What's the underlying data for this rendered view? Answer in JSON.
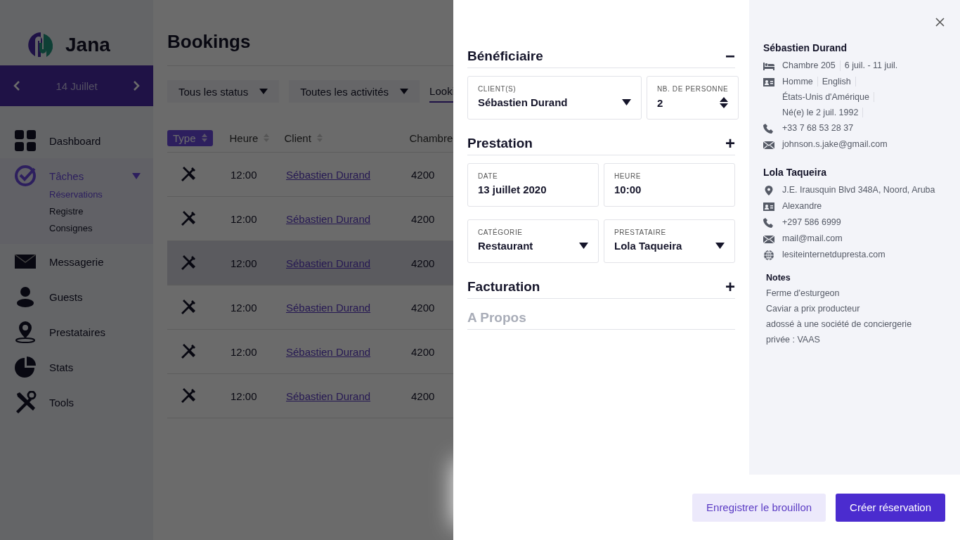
{
  "sidebar": {
    "brand": "Jana",
    "date": "14 Juillet",
    "nav": [
      {
        "label": "Dashboard",
        "selected": false
      },
      {
        "label": "Tâches",
        "selected": true,
        "expanded": true,
        "children": [
          {
            "label": "Réservations",
            "selected": true
          },
          {
            "label": "Registre",
            "selected": false
          },
          {
            "label": "Consignes",
            "selected": false
          }
        ]
      },
      {
        "label": "Messagerie",
        "selected": false
      },
      {
        "label": "Guests",
        "selected": false
      },
      {
        "label": "Prestataires",
        "selected": false
      },
      {
        "label": "Stats",
        "selected": false
      },
      {
        "label": "Tools",
        "selected": false
      }
    ]
  },
  "page": {
    "title": "Bookings",
    "filters": [
      {
        "kind": "select",
        "label": "Tous les status"
      },
      {
        "kind": "select",
        "label": "Toutes les activités"
      },
      {
        "kind": "search",
        "value": "Looki"
      }
    ],
    "table": {
      "columns": [
        {
          "label": "Type",
          "selected": true
        },
        {
          "label": "Heure",
          "selected": false
        },
        {
          "label": "Client",
          "selected": false
        },
        {
          "label": "Chambre",
          "selected": false
        }
      ],
      "rows": [
        {
          "time": "12:00",
          "client": "Sébastien Durand",
          "room": "4200",
          "highlighted": false
        },
        {
          "time": "12:00",
          "client": "Sébastien Durand",
          "room": "4200",
          "highlighted": false
        },
        {
          "time": "12:00",
          "client": "Sébastien Durand",
          "room": "4200",
          "highlighted": true
        },
        {
          "time": "12:00",
          "client": "Sébastien Durand",
          "room": "4200",
          "highlighted": false
        },
        {
          "time": "12:00",
          "client": "Sébastien Durand",
          "room": "4200",
          "highlighted": false
        },
        {
          "time": "12:00",
          "client": "Sébastien Durand",
          "room": "4200",
          "highlighted": false
        }
      ]
    }
  },
  "drawer": {
    "sections": [
      {
        "title": "Bénéficiaire",
        "toggle": "−",
        "disabled": false,
        "field_rows": [
          [
            {
              "kind": "select",
              "label": "CLIENT(S)",
              "value": "Sébastien Durand",
              "wide": true
            },
            {
              "kind": "stepper",
              "label": "NB. DE PERSONNE",
              "value": "2",
              "wide": false
            }
          ]
        ]
      },
      {
        "title": "Prestation",
        "toggle": "+",
        "disabled": false,
        "field_rows": [
          [
            {
              "kind": "text",
              "label": "DATE",
              "value": "13 juillet 2020",
              "wide": false
            },
            {
              "kind": "text",
              "label": "HEURE",
              "value": "10:00",
              "wide": false
            }
          ],
          [
            {
              "kind": "select",
              "label": "CATÉGORIE",
              "value": "Restaurant",
              "wide": false
            },
            {
              "kind": "select",
              "label": "PRESTATAIRE",
              "value": "Lola Taqueira",
              "wide": false
            }
          ]
        ]
      },
      {
        "title": "Facturation",
        "toggle": "+",
        "disabled": false
      },
      {
        "title": "A Propos",
        "disabled": true
      }
    ],
    "info": [
      {
        "name": "Sébastien Durand",
        "lines": [
          {
            "kind": "room",
            "parts": [
              "Chambre 205",
              "6 juil. - 11 juil."
            ]
          },
          {
            "kind": "identity",
            "parts": [
              "Homme",
              "English",
              "États-Unis d'Amérique",
              "Né(e) le 2 juil. 1992"
            ]
          },
          {
            "kind": "phone",
            "parts": [
              "+33 7 68 53 28 37"
            ]
          },
          {
            "kind": "email",
            "parts": [
              "johnson.s.jake@gmail.com"
            ]
          }
        ]
      },
      {
        "name": "Lola Taqueira",
        "lines": [
          {
            "kind": "address",
            "parts": [
              "J.E. Irausquin Blvd 348A, Noord, Aruba"
            ]
          },
          {
            "kind": "identity",
            "parts": [
              "Alexandre"
            ]
          },
          {
            "kind": "phone",
            "parts": [
              "+297 586 6999"
            ]
          },
          {
            "kind": "email",
            "parts": [
              "mail@mail.com"
            ]
          },
          {
            "kind": "website",
            "parts": [
              "lesiteinternetdupresta.com"
            ]
          }
        ]
      }
    ],
    "notes": {
      "title": "Notes",
      "lines": [
        "Ferme d'esturgeon",
        "Caviar a prix producteur",
        "adossé à une société de conciergerie",
        "privée : VAAS"
      ]
    },
    "buttons": [
      {
        "kind": "secondary",
        "label": "Enregistrer le brouillon"
      },
      {
        "kind": "primary",
        "label": "Créer réservation"
      }
    ]
  }
}
